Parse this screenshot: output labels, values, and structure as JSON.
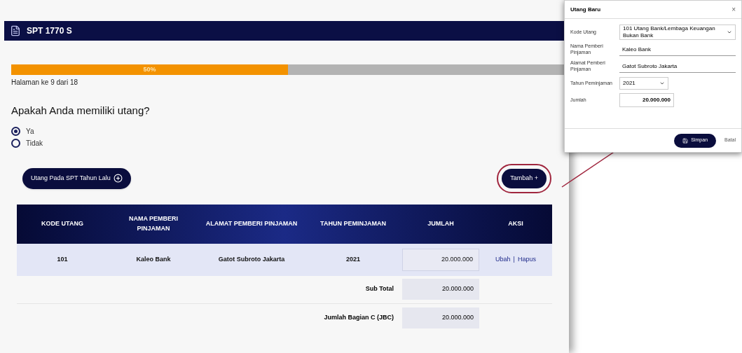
{
  "header": {
    "title": "SPT 1770 S"
  },
  "progress": {
    "level": 0.5,
    "label": "50%"
  },
  "page_info": "Halaman ke 9 dari 18",
  "question": "Apakah Anda memiliki utang?",
  "options": [
    {
      "label": "Ya",
      "selected": true
    },
    {
      "label": "Tidak",
      "selected": false
    }
  ],
  "prev_button": "Utang Pada SPT Tahun Lalu",
  "add_button": "Tambah +",
  "table": {
    "columns": [
      "KODE UTANG",
      "NAMA PEMBERI PINJAMAN",
      "ALAMAT PEMBERI PINJAMAN",
      "TAHUN PEMINJAMAN",
      "JUMLAH",
      "AKSI"
    ],
    "rows": [
      {
        "code": "101",
        "name": "Kaleo Bank",
        "address": "Gatot Subroto Jakarta",
        "year": "2021",
        "amount": "20.000.000",
        "edit": "Ubah",
        "separator": "|",
        "delete": "Hapus"
      }
    ],
    "subtotal_label": "Sub Total",
    "subtotal": "20.000.000",
    "total_label": "Jumlah Bagian C (JBC)",
    "total": "20.000.000"
  },
  "dialog": {
    "title": "Utang Baru",
    "close": "×",
    "fields": [
      {
        "kind": "select",
        "label": "Kode Utang",
        "value": "101 Utang Bank/Lembaga Keuangan Bukan Bank"
      },
      {
        "kind": "text",
        "label": "Nama Pemberi Pinjaman",
        "value": "Kaleo Bank"
      },
      {
        "kind": "text",
        "label": "Alamat Pemberi Pinjaman",
        "value": "Gatot Subroto Jakarta"
      },
      {
        "kind": "select",
        "label": "Tahun Peminjaman",
        "value": "2021"
      },
      {
        "kind": "amount",
        "label": "Jumlah",
        "value": "20.000.000"
      }
    ],
    "save": "Simpan",
    "cancel": "Batal"
  }
}
